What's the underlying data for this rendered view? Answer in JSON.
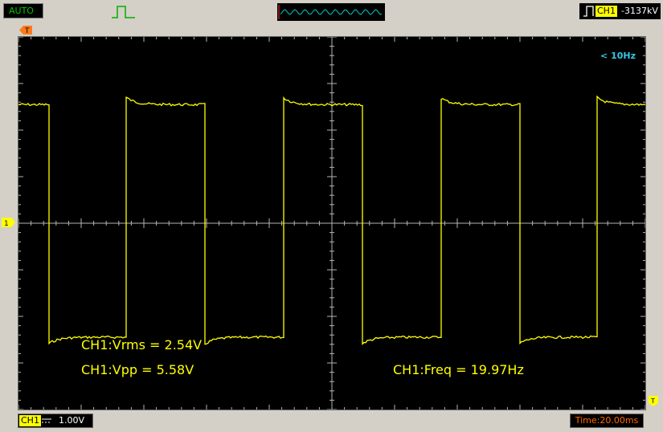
{
  "header": {
    "mode": "AUTO",
    "trigger": {
      "channel": "CH1",
      "level": "-3137kV"
    }
  },
  "screen": {
    "frequency_warning": "< 10Hz",
    "measurements": {
      "vrms": "CH1:Vrms = 2.54V",
      "vpp": "CH1:Vpp = 5.58V",
      "freq": "CH1:Freq = 19.97Hz"
    },
    "divisions": {
      "horizontal": 10,
      "vertical": 8
    },
    "waveform": {
      "type": "square",
      "color": "#ffff00",
      "frequency_hz": 19.97,
      "vpp_v": 5.58,
      "high_v": 2.65,
      "low_v": -2.55,
      "volts_per_div": 1.0,
      "ms_per_div": 20
    }
  },
  "footer": {
    "channel": "CH1",
    "scale": "1.00V",
    "time": "Time:20.00ms"
  },
  "colors": {
    "trace": "#ffff00",
    "grid": "#b4b4b4",
    "mode_text": "#00c800",
    "time_text": "#ff6a00",
    "warning_text": "#33c8e6"
  }
}
